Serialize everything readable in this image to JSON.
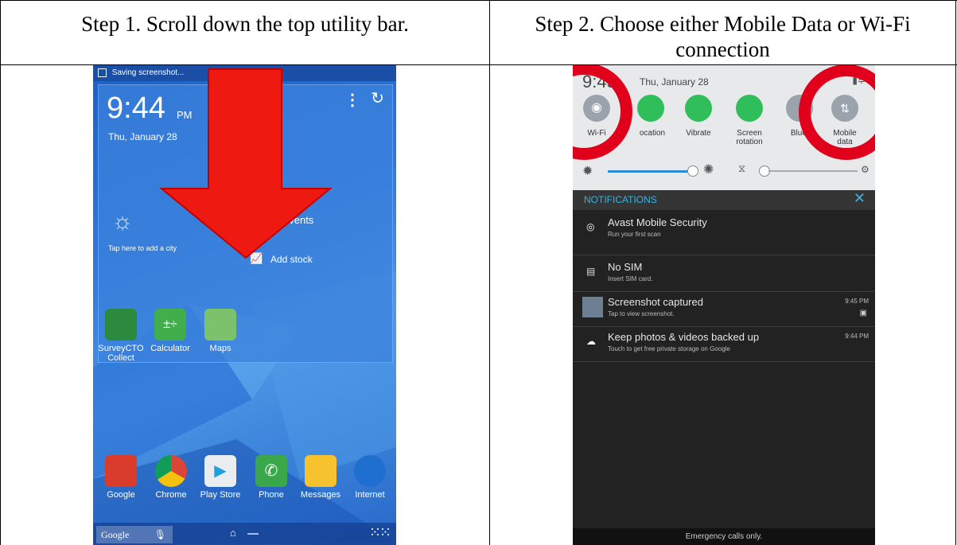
{
  "table": {
    "step1_header": "Step 1. Scroll down the top utility bar.",
    "step2_header_line1": "Step 2. Choose either Mobile Data or Wi-Fi",
    "step2_header_line2": "connection"
  },
  "left_phone": {
    "status_text": "Saving screenshot...",
    "time": "9:44",
    "ampm": "PM",
    "date": "Thu, January 28",
    "weather_hint": "Tap here to add a city",
    "events_label": "events",
    "stock_label": "Add stock",
    "apps_row1": [
      "SurveyCTO Collect",
      "Calculator",
      "Maps"
    ],
    "apps_row2": [
      "Google",
      "Chrome",
      "Play Store",
      "Phone",
      "Messages",
      "Internet"
    ],
    "search_label": "Google"
  },
  "right_phone": {
    "time": "9:45",
    "date": "Thu, January 28",
    "toggles": [
      "Wi-Fi",
      "Location",
      "Vibrate",
      "Screen rotation",
      "Bluetooth",
      "Mobile data"
    ],
    "toggle_labels_display": [
      "Wi-Fi",
      "ocation",
      "Vibrate",
      "Screen\nrotation",
      "Blueto",
      "Mobile\ndata"
    ],
    "notifications_title": "NOTIFICATIONS",
    "notifications": [
      {
        "title": "Avast Mobile Security",
        "sub": "Run your first scan",
        "time": ""
      },
      {
        "title": "No SIM",
        "sub": "Insert SIM card.",
        "time": ""
      },
      {
        "title": "Screenshot captured",
        "sub": "Tap to view screenshot.",
        "time": "9:45 PM"
      },
      {
        "title": "Keep photos & videos backed up",
        "sub": "Touch to get free private storage on Google",
        "time": "9:44 PM"
      }
    ],
    "footer": "Emergency calls only."
  },
  "colors": {
    "annotation_red": "#e0001c",
    "arrow_red": "#ee1a12"
  }
}
